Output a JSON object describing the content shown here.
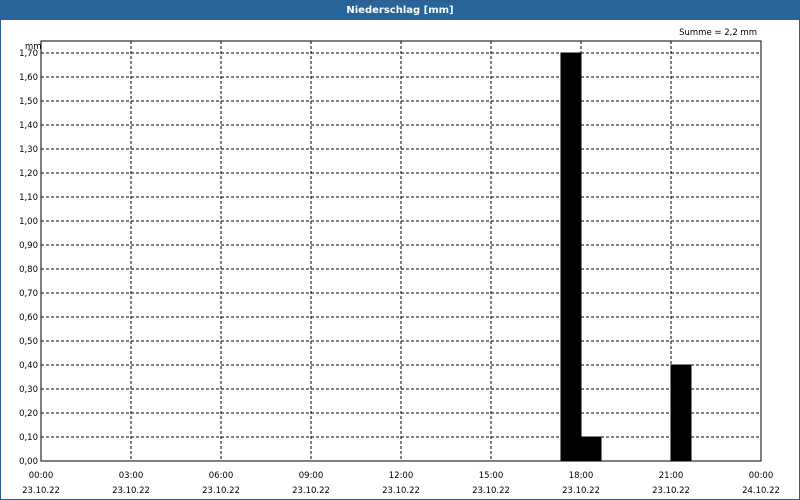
{
  "window": {
    "title": "Niederschlag [mm]"
  },
  "summary": "Summe = 2,2 mm",
  "chart_data": {
    "type": "bar",
    "title": "Niederschlag [mm]",
    "ylabel": "mm",
    "xlabel": "",
    "ylim": [
      0,
      1.75
    ],
    "y_ticks": [
      0.0,
      0.1,
      0.2,
      0.3,
      0.4,
      0.5,
      0.6,
      0.7,
      0.8,
      0.9,
      1.0,
      1.1,
      1.2,
      1.3,
      1.4,
      1.5,
      1.6,
      1.7
    ],
    "y_tick_labels": [
      "0,00",
      "0,10",
      "0,20",
      "0,30",
      "0,40",
      "0,50",
      "0,60",
      "0,70",
      "0,80",
      "0,90",
      "1,00",
      "1,10",
      "1,20",
      "1,30",
      "1,40",
      "1,50",
      "1,60",
      "1,70"
    ],
    "x_range": [
      "2022-10-23 00:00",
      "2022-10-24 00:00"
    ],
    "x_ticks": [
      {
        "time": "00:00",
        "date": "23.10.22"
      },
      {
        "time": "03:00",
        "date": "23.10.22"
      },
      {
        "time": "06:00",
        "date": "23.10.22"
      },
      {
        "time": "09:00",
        "date": "23.10.22"
      },
      {
        "time": "12:00",
        "date": "23.10.22"
      },
      {
        "time": "15:00",
        "date": "23.10.22"
      },
      {
        "time": "18:00",
        "date": "23.10.22"
      },
      {
        "time": "21:00",
        "date": "23.10.22"
      },
      {
        "time": "00:00",
        "date": "24.10.22"
      }
    ],
    "bar_width_hours": 0.667,
    "x": [
      "2022-10-23 17:40",
      "2022-10-23 18:20",
      "2022-10-23 21:20"
    ],
    "values": [
      1.7,
      0.1,
      0.4
    ],
    "grid": true,
    "bar_color": "#000000"
  }
}
